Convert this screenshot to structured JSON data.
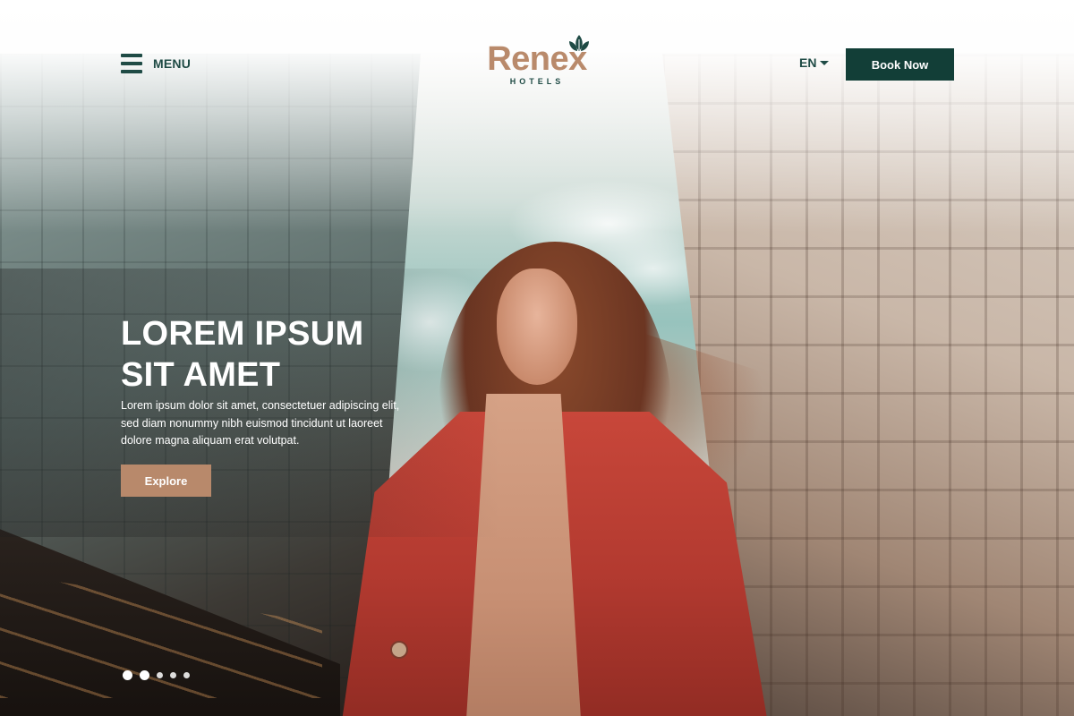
{
  "header": {
    "menu_label": "MENU",
    "logo": {
      "wordmark": "Renex",
      "subtitle": "HOTELS"
    },
    "language": "EN",
    "book_label": "Book Now"
  },
  "hero": {
    "title": "LOREM IPSUM\nSIT AMET",
    "description": "Lorem ipsum dolor sit amet, consectetuer adipiscing elit, sed diam nonummy nibh euismod tincidunt ut laoreet dolore magna aliquam erat volutpat.",
    "cta_label": "Explore"
  },
  "carousel": {
    "slide_count": 5,
    "active_slides": [
      1,
      2
    ]
  },
  "icons": {
    "menu": "hamburger-icon",
    "logo_mark": "leaf-icon",
    "language_caret": "caret-down-icon"
  },
  "colors": {
    "brand_dark": "#123e37",
    "brand_text": "#1f4b45",
    "accent_tan": "#b8896b",
    "logo_tan": "#b98a6b"
  }
}
